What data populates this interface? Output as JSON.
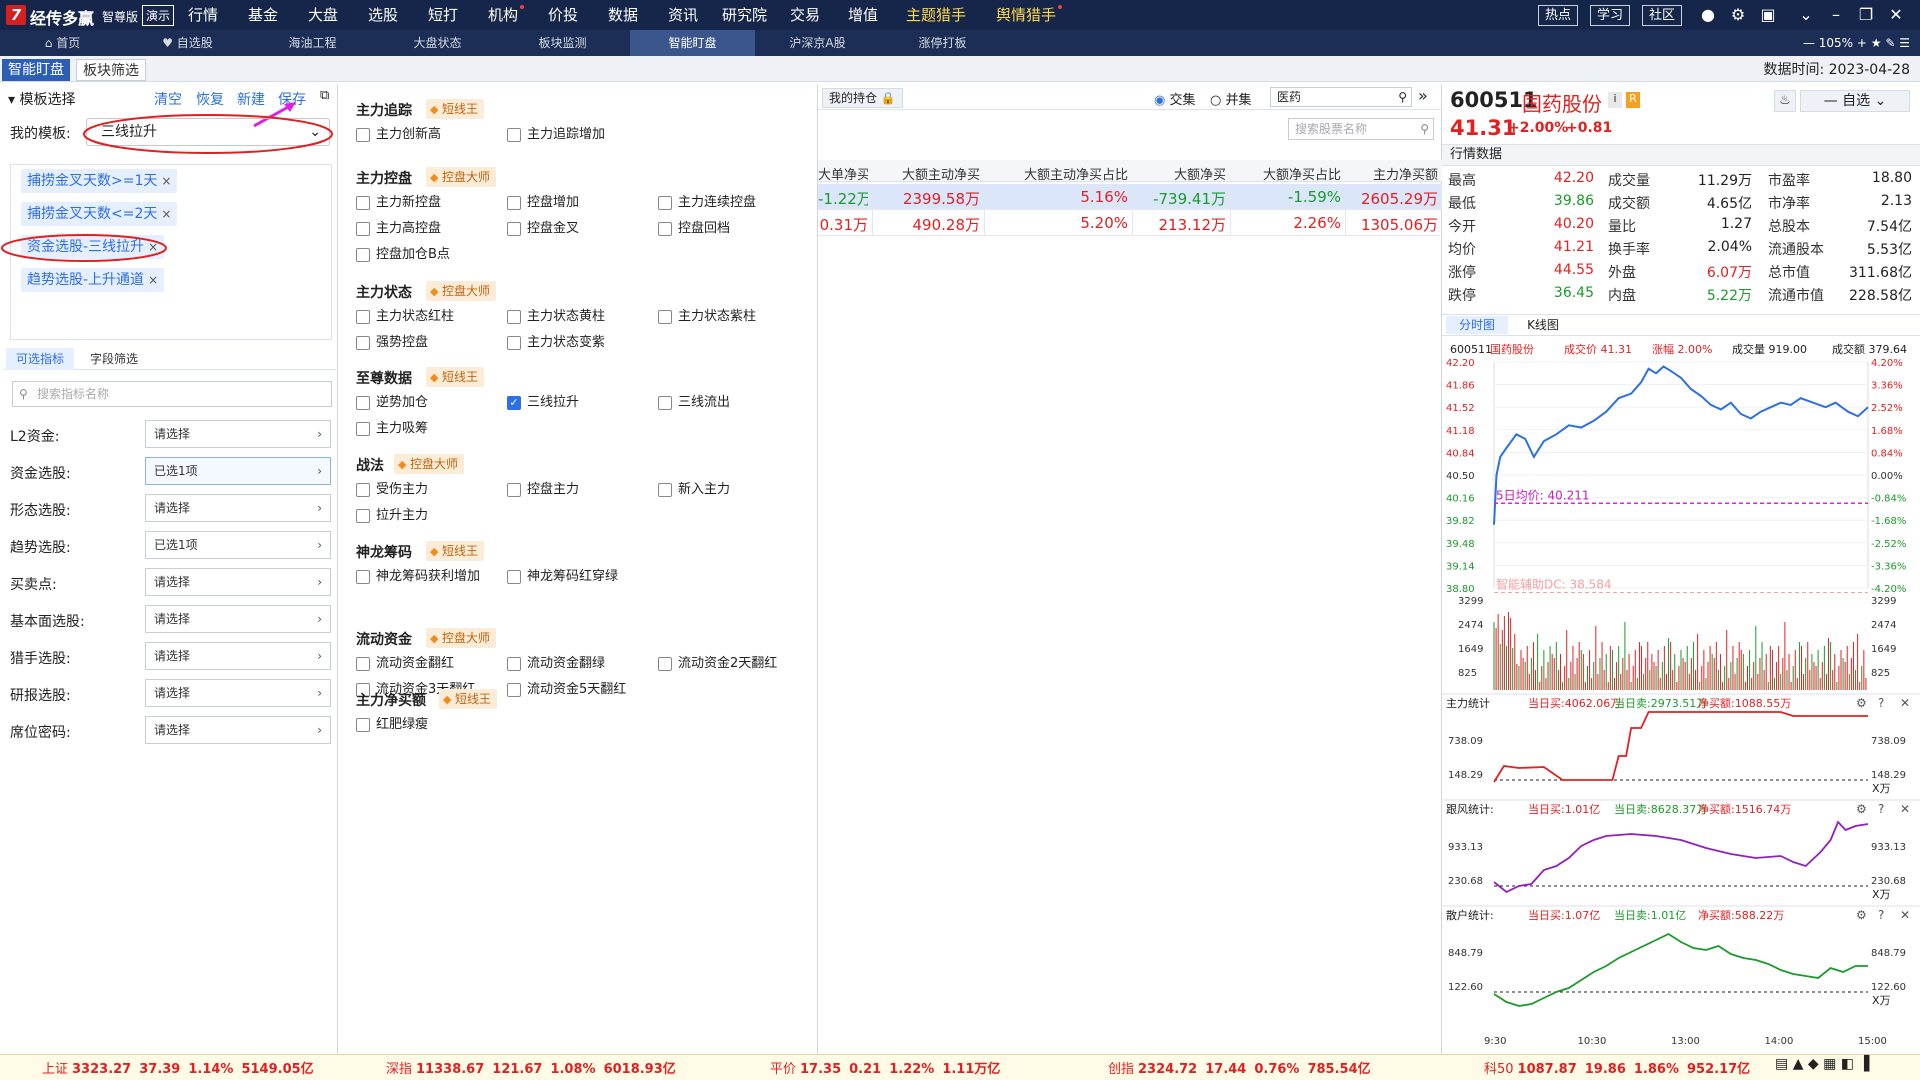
{
  "app": {
    "name": "经传多赢",
    "edition": "智尊版",
    "demo": "演示"
  },
  "menu": [
    {
      "label": "行情"
    },
    {
      "label": "基金"
    },
    {
      "label": "大盘"
    },
    {
      "label": "选股"
    },
    {
      "label": "短打"
    },
    {
      "label": "机构"
    },
    {
      "label": "价投"
    },
    {
      "label": "数据"
    },
    {
      "label": "资讯"
    },
    {
      "label": "研究院"
    },
    {
      "label": "交易"
    },
    {
      "label": "增值"
    },
    {
      "label": "主题猎手"
    },
    {
      "label": "舆情猎手"
    }
  ],
  "topbuttons": {
    "hot": "热点",
    "study": "学习",
    "community": "社区"
  },
  "nav": {
    "home": "首页",
    "self": "自选股",
    "t1": "海油工程",
    "t2": "大盘状态",
    "t3": "板块监测",
    "t4": "智能盯盘",
    "t5": "沪深京A股",
    "t6": "涨停打板",
    "zoom": "105%"
  },
  "subtabs": {
    "a": "智能盯盘",
    "b": "板块筛选",
    "datatime_label": "数据时间:",
    "datatime": "2023-04-28"
  },
  "left": {
    "title": "模板选择",
    "clear": "清空",
    "restore": "恢复",
    "new": "新建",
    "save": "保存",
    "my_tpl": "我的模板:",
    "tpl_value": "三线拉升",
    "tags": [
      "捕捞金叉天数>=1天",
      "捕捞金叉天数<=2天",
      "资金选股-三线拉升",
      "趋势选股-上升通道"
    ],
    "tab1": "可选指标",
    "tab2": "字段筛选",
    "search_ph": "搜索指标名称",
    "filters": [
      {
        "label": "L2资金:",
        "value": "请选择"
      },
      {
        "label": "资金选股:",
        "value": "已选1项"
      },
      {
        "label": "形态选股:",
        "value": "请选择"
      },
      {
        "label": "趋势选股:",
        "value": "已选1项"
      },
      {
        "label": "买卖点:",
        "value": "请选择"
      },
      {
        "label": "基本面选股:",
        "value": "请选择"
      },
      {
        "label": "猎手选股:",
        "value": "请选择"
      },
      {
        "label": "研报选股:",
        "value": "请选择"
      },
      {
        "label": "席位密码:",
        "value": "请选择"
      }
    ]
  },
  "mid": {
    "sections": [
      {
        "title": "主力追踪",
        "badge": "短线王",
        "items": [
          "主力创新高",
          "主力追踪增加"
        ]
      },
      {
        "title": "主力控盘",
        "badge": "控盘大师",
        "items": [
          "主力新控盘",
          "控盘增加",
          "主力连续控盘",
          "主力高控盘",
          "控盘金叉",
          "控盘回档",
          "控盘加仓B点"
        ]
      },
      {
        "title": "主力状态",
        "badge": "控盘大师",
        "items": [
          "主力状态红柱",
          "主力状态黄柱",
          "主力状态紫柱",
          "强势控盘",
          "主力状态变紫"
        ]
      },
      {
        "title": "至尊数据",
        "badge": "短线王",
        "items": [
          "逆势加仓",
          "三线拉升",
          "三线流出",
          "主力吸筹"
        ]
      },
      {
        "title": "战法",
        "badge": "控盘大师",
        "items": [
          "受伤主力",
          "控盘主力",
          "新入主力",
          "拉升主力"
        ]
      },
      {
        "title": "神龙筹码",
        "badge": "短线王",
        "items": [
          "神龙筹码获利增加",
          "神龙筹码红穿绿"
        ]
      },
      {
        "title": "流动资金",
        "badge": "控盘大师",
        "items": [
          "流动资金翻红",
          "流动资金翻绿",
          "流动资金2天翻红",
          "流动资金3天翻红",
          "流动资金5天翻红"
        ]
      },
      {
        "title": "主力净买额",
        "badge": "短线王",
        "items": [
          "红肥绿瘦"
        ]
      }
    ]
  },
  "table": {
    "myhold": "我的持仓",
    "and": "交集",
    "or": "并集",
    "sector": "医药",
    "search_ph": "搜索股票名称",
    "headers": [
      "大单净买",
      "大额主动净买",
      "大额主动净买占比",
      "大额净买",
      "大额净买占比",
      "主力净买额"
    ],
    "rows": [
      [
        "-1.22万",
        "2399.58万",
        "5.16%",
        "-739.41万",
        "-1.59%",
        "2605.29万"
      ],
      [
        "0.31万",
        "490.28万",
        "5.20%",
        "213.12万",
        "2.26%",
        "1305.06万"
      ]
    ]
  },
  "stock": {
    "code": "600511",
    "name": "国药股份",
    "price": "41.31",
    "pct": "+2.00%",
    "chg": "+0.81",
    "selfbtn": "自选",
    "section": "行情数据",
    "quotes": [
      [
        "最高",
        "42.20",
        "成交量",
        "11.29万",
        "市盈率",
        "18.80"
      ],
      [
        "最低",
        "39.86",
        "成交额",
        "4.65亿",
        "市净率",
        "2.13"
      ],
      [
        "今开",
        "40.20",
        "量比",
        "1.27",
        "总股本",
        "7.54亿"
      ],
      [
        "均价",
        "41.21",
        "换手率",
        "2.04%",
        "流通股本",
        "5.53亿"
      ],
      [
        "涨停",
        "44.55",
        "外盘",
        "6.07万",
        "总市值",
        "311.68亿"
      ],
      [
        "跌停",
        "36.45",
        "内盘",
        "5.22万",
        "流通市值",
        "228.58亿"
      ]
    ],
    "tabs": [
      "分时图",
      "K线图"
    ],
    "chart_header": {
      "code": "600511",
      "name": "国药股份",
      "price_lbl": "成交价 41.31",
      "pct_lbl": "涨幅 2.00%",
      "vol_lbl": "成交量 919.00",
      "amt_lbl": "成交额 379.64"
    },
    "avg_lbl": "5日均价: 40.211",
    "dc_lbl": "智能辅助DC: 38.584",
    "price_ticks": [
      "42.20",
      "41.86",
      "41.52",
      "41.18",
      "40.84",
      "40.50",
      "40.16",
      "39.82",
      "39.48",
      "39.14",
      "38.80"
    ],
    "pct_ticks": [
      "4.20%",
      "3.36%",
      "2.52%",
      "1.68%",
      "0.84%",
      "0.00%",
      "-0.84%",
      "-1.68%",
      "-2.52%",
      "-3.36%",
      "-4.20%"
    ],
    "vol_ticks": [
      "3299",
      "2474",
      "1649",
      "825"
    ],
    "ind1": {
      "title": "主力统计",
      "buy": "当日买:4062.06万",
      "sell": "当日卖:2973.51万",
      "net": "净买额:1088.55万",
      "t1": "738.09",
      "t2": "148.29",
      "unit": "X万"
    },
    "ind2": {
      "title": "跟风统计:",
      "buy": "当日买:1.01亿",
      "sell": "当日卖:8628.37万",
      "net": "净买额:1516.74万",
      "t1": "933.13",
      "t2": "230.68",
      "unit": "X万"
    },
    "ind3": {
      "title": "散户统计:",
      "buy": "当日买:1.07亿",
      "sell": "当日卖:1.01亿",
      "net": "净买额:588.22万",
      "t1": "848.79",
      "t2": "122.60",
      "unit": "X万"
    },
    "time_ticks": [
      "9:30",
      "10:30",
      "13:00",
      "14:00",
      "15:00"
    ]
  },
  "ticker": [
    {
      "name": "上证",
      "v": "3323.27",
      "c": "37.39",
      "p": "1.14%",
      "a": "5149.05亿"
    },
    {
      "name": "深指",
      "v": "11338.67",
      "c": "121.67",
      "p": "1.08%",
      "a": "6018.93亿"
    },
    {
      "name": "平价",
      "v": "17.35",
      "c": "0.21",
      "p": "1.22%",
      "a": "1.11万亿"
    },
    {
      "name": "创指",
      "v": "2324.72",
      "c": "17.44",
      "p": "0.76%",
      "a": "785.54亿"
    },
    {
      "name": "科50",
      "v": "1087.87",
      "c": "19.86",
      "p": "1.86%",
      "a": "952.17亿"
    }
  ],
  "colors": {
    "up": "#e22020",
    "down": "#1a9a2a",
    "accent": "#2d6fe6",
    "titlebar": "#16264a"
  }
}
